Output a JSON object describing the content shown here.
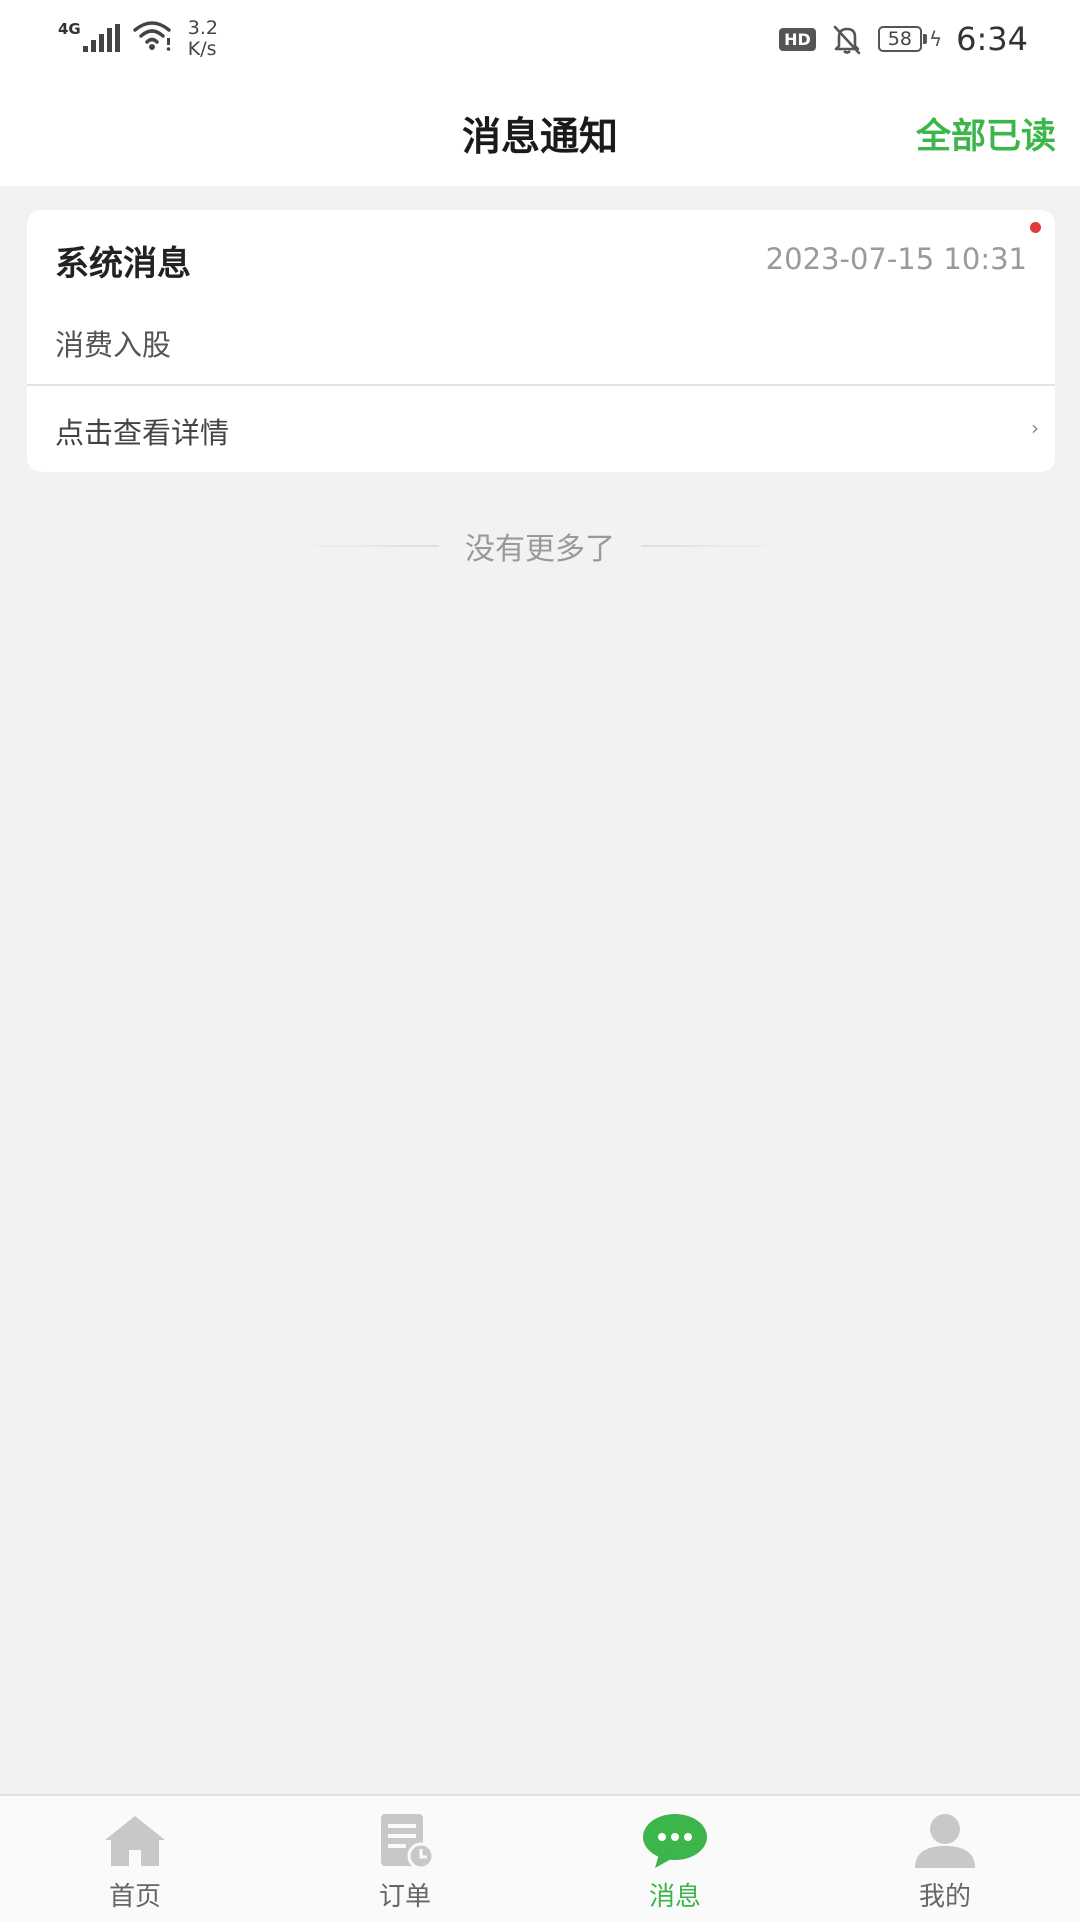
{
  "status_bar": {
    "network": "4G",
    "speed_value": "3.2",
    "speed_unit": "K/s",
    "hd_label": "HD",
    "battery": "58",
    "time": "6:34"
  },
  "header": {
    "title": "消息通知",
    "mark_all_read": "全部已读",
    "accent_color": "#3cb54a"
  },
  "messages": [
    {
      "title": "系统消息",
      "time": "2023-07-15 10:31",
      "content": "消费入股",
      "link_label": "点击查看详情",
      "link_icon": "chevron-right-icon",
      "unread": true
    }
  ],
  "list_footer": "没有更多了",
  "tabbar": {
    "items": [
      {
        "label": "首页",
        "icon": "home-icon",
        "active": false
      },
      {
        "label": "订单",
        "icon": "order-icon",
        "active": false
      },
      {
        "label": "消息",
        "icon": "chat-icon",
        "active": true
      },
      {
        "label": "我的",
        "icon": "user-icon",
        "active": false
      }
    ]
  }
}
